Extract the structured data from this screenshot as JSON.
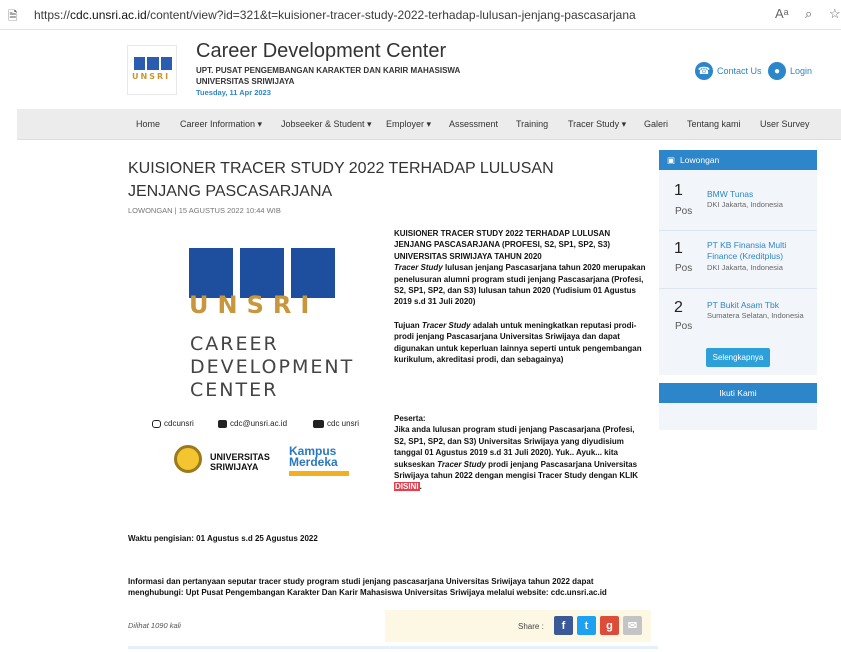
{
  "browser": {
    "url_prefix": "https://",
    "url_domain": "cdc.unsri.ac.id",
    "url_path": "/content/view?id=321&t=kuisioner-tracer-study-2022-terhadap-lulusan-jenjang-pascasarjana",
    "reader_icon": "Aᵃ",
    "zoom_icon": "⌕",
    "fav_icon": "☆"
  },
  "header": {
    "logo_letters": "UNSRI",
    "title": "Career Development Center",
    "subtitle1": "UPT. PUSAT PENGEMBANGAN KARAKTER DAN KARIR MAHASISWA",
    "subtitle2": "UNIVERSITAS SRIWIJAYA",
    "date": "Tuesday, 11 Apr 2023",
    "contact_label": "Contact Us",
    "login_label": "Login"
  },
  "nav": [
    "Home",
    "Career Information ▾",
    "Jobseeker & Student ▾",
    "Employer ▾",
    "Assessment",
    "Training",
    "Tracer Study ▾",
    "Galeri",
    "Tentang kami",
    "User Survey"
  ],
  "article": {
    "title": "KUISIONER TRACER STUDY 2022 TERHADAP LULUSAN JENJANG PASCASARJANA",
    "meta": "LOWONGAN | 15 AGUSTUS 2022 10:44 WIB",
    "banner": {
      "unsri": "UNSRI",
      "line1": "CAREER",
      "line2": "DEVELOPMENT",
      "line3": "CENTER",
      "instagram": "cdcunsri",
      "email": "cdc@unsri.ac.id",
      "youtube": "cdc unsri",
      "uni1": "UNIVERSITAS",
      "uni2": "SRIWIJAYA",
      "kampus1": "Kampus",
      "kampus2": "Merdeka"
    },
    "p1_heading": "KUISIONER TRACER STUDY 2022 TERHADAP LULUSAN JENJANG PASCASARJANA (PROFESI, S2, SP1, SP2, S3) UNIVERSITAS SRIWIJAYA TAHUN 2020",
    "p1_italic": "Tracer Study",
    "p1_rest": " lulusan jenjang Pascasarjana tahun 2020 merupakan penelusuran alumni program studi jenjang Pascasarjana (Profesi, S2, SP1, SP2, dan S3) lulusan tahun 2020 (Yudisium 01 Agustus 2019 s.d 31 Juli 2020)",
    "p2_pre": "Tujuan ",
    "p2_italic": "Tracer Study",
    "p2_rest": " adalah untuk meningkatkan reputasi prodi-prodi jenjang Pascasarjana Universitas Sriwijaya dan dapat digunakan untuk keperluan lainnya seperti untuk pengembangan kurikulum, akreditasi prodi, dan sebagainya)",
    "p3_label": "Peserta:",
    "p3_pre": "Jika anda lulusan program studi jenjang Pascasarjana (Profesi, S2, SP1, SP2, dan S3) Universitas Sriwijaya yang diyudisium tanggal 01 Agustus 2019 s.d 31 Juli 2020). Yuk.. Ayuk... kita sukseskan ",
    "p3_italic": "Tracer Study",
    "p3_rest": " prodi jenjang Pascasarjana Universitas Sriwijaya tahun 2022 dengan mengisi Tracer Study dengan KLIK ",
    "p3_link": "DISINI",
    "p3_end": ".",
    "waktu": "Waktu pengisian: 01 Agustus s.d 25 Agustus 2022",
    "info": "Informasi dan pertanyaan seputar tracer study program studi jenjang pascasarjana Universitas Sriwijaya tahun 2022 dapat menghubungi: Upt Pusat Pengembangan Karakter Dan Karir  Mahasiswa Universitas Sriwijaya melalui website: cdc.unsri.ac.id",
    "views": "Dilihat 1090 kali",
    "share_label": "Share :"
  },
  "sidebar": {
    "lowongan_title": "Lowongan",
    "jobs": [
      {
        "num": "1",
        "pos": "Pos",
        "name": "BMW Tunas",
        "loc": "DKI Jakarta, Indonesia"
      },
      {
        "num": "1",
        "pos": "Pos",
        "name": "PT KB Finansia Multi Finance (Kreditplus)",
        "loc": "DKI Jakarta, Indonesia"
      },
      {
        "num": "2",
        "pos": "Pos",
        "name": "PT Bukit Asam Tbk",
        "loc": "Sumatera Selatan, Indonesia"
      }
    ],
    "more_label": "Selengkapnya",
    "follow_title": "Ikuti Kami"
  },
  "colors": {
    "accent": "#2d86c9",
    "gold": "#c8963d",
    "highlight": "#e2404f"
  }
}
